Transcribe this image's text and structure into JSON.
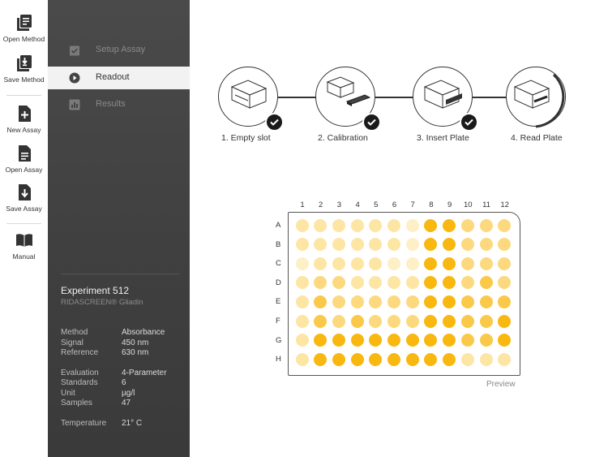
{
  "toolbar": {
    "open_method": "Open Method",
    "save_method": "Save Method",
    "new_assay": "New Assay",
    "open_assay": "Open Assay",
    "save_assay": "Save Assay",
    "manual": "Manual"
  },
  "nav": {
    "setup": "Setup Assay",
    "readout": "Readout",
    "results": "Results"
  },
  "experiment": {
    "title": "Experiment 512",
    "subtitle": "RIDASCREEN® Gliadin",
    "method_k": "Method",
    "method_v": "Absorbance",
    "signal_k": "Signal",
    "signal_v": "450 nm",
    "reference_k": "Reference",
    "reference_v": "630 nm",
    "evaluation_k": "Evaluation",
    "evaluation_v": "4-Parameter",
    "standards_k": "Standards",
    "standards_v": "6",
    "unit_k": "Unit",
    "unit_v": "µg/l",
    "samples_k": "Samples",
    "samples_v": "47",
    "temperature_k": "Temperature",
    "temperature_v": "21° C"
  },
  "steps": {
    "s1": "1. Empty slot",
    "s2": "2. Calibration",
    "s3": "3. Insert Plate",
    "s4": "4. Read Plate"
  },
  "plate": {
    "columns": [
      "1",
      "2",
      "3",
      "4",
      "5",
      "6",
      "7",
      "8",
      "9",
      "10",
      "11",
      "12"
    ],
    "rows": [
      "A",
      "B",
      "C",
      "D",
      "E",
      "F",
      "G",
      "H"
    ],
    "preview_label": "Preview",
    "palette": [
      "#fdefc6",
      "#fde5a4",
      "#fcd97e",
      "#fbc94a",
      "#f9b810"
    ],
    "levels": [
      [
        1,
        1,
        1,
        1,
        1,
        1,
        0,
        4,
        4,
        2,
        2,
        2
      ],
      [
        1,
        1,
        1,
        1,
        1,
        1,
        0,
        4,
        4,
        2,
        2,
        2
      ],
      [
        0,
        1,
        1,
        1,
        1,
        0,
        0,
        4,
        4,
        2,
        2,
        2
      ],
      [
        1,
        2,
        2,
        1,
        1,
        1,
        1,
        4,
        4,
        2,
        3,
        2
      ],
      [
        1,
        3,
        2,
        2,
        2,
        2,
        2,
        4,
        4,
        3,
        3,
        3
      ],
      [
        1,
        3,
        2,
        3,
        2,
        2,
        2,
        4,
        4,
        3,
        3,
        4
      ],
      [
        1,
        4,
        4,
        4,
        4,
        4,
        4,
        4,
        4,
        3,
        3,
        4
      ],
      [
        1,
        4,
        4,
        4,
        4,
        4,
        4,
        4,
        4,
        1,
        1,
        1
      ]
    ]
  }
}
